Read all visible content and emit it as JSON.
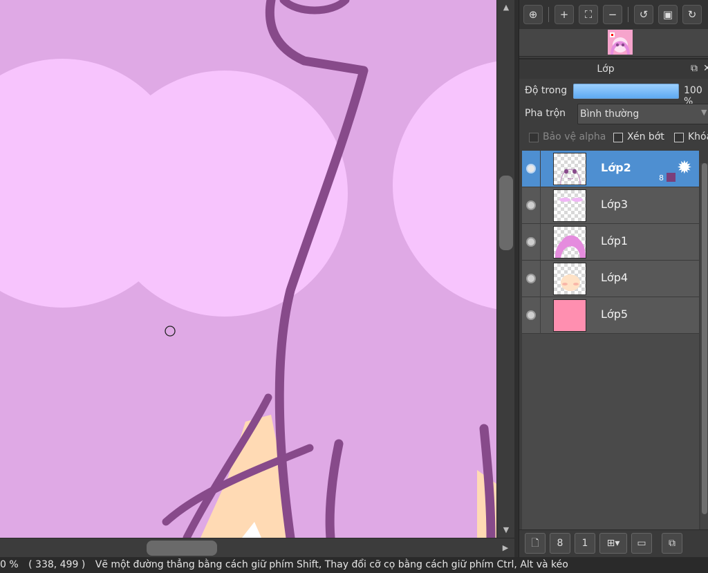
{
  "statusbar": {
    "zoom": "0 %",
    "coords": "( 338, 499 )",
    "hint": "Vẽ một đường thẳng bằng cách giữ phím Shift, Thay đổi cỡ cọ bằng cách giữ phím Ctrl, Alt và kéo"
  },
  "navigator": {
    "tools": [
      "zoom-actual-icon",
      "zoom-in-icon",
      "fit-icon",
      "zoom-out-icon",
      "rotate-left-icon",
      "fullscreen-icon",
      "rotate-right-icon"
    ]
  },
  "layer_panel": {
    "title": "Lớp",
    "opacity_label": "Độ trong",
    "opacity_value": "100 %",
    "opacity_level": 1.0,
    "blend_label": "Pha trộn",
    "blend_value": "Bình thường",
    "protect_alpha": "Bảo vệ alpha",
    "clipping": "Xén bớt",
    "lock": "Khóa",
    "layers": [
      {
        "name": "Lớp2",
        "selected": true,
        "badge": "8"
      },
      {
        "name": "Lớp3",
        "selected": false
      },
      {
        "name": "Lớp1",
        "selected": false
      },
      {
        "name": "Lớp4",
        "selected": false
      },
      {
        "name": "Lớp5",
        "selected": false
      }
    ]
  },
  "colors": {
    "canvas_bg": "#dfa9e5",
    "bubble": "#f7c4fd",
    "line": "#874a8a",
    "skin": "#ffdab4",
    "selection": "#4e8fd1"
  }
}
